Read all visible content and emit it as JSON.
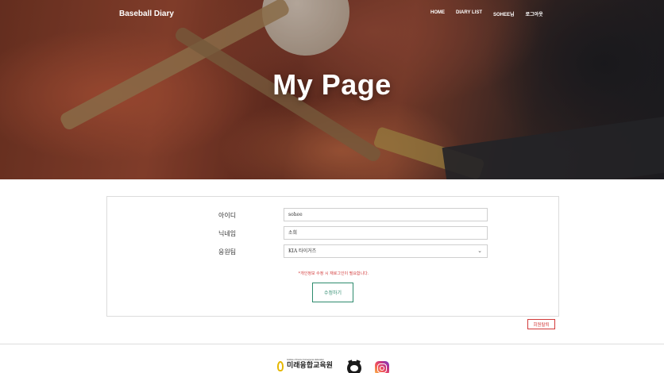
{
  "nav": {
    "brand": "Baseball Diary",
    "links": [
      "HOME",
      "DIARY LIST",
      "SOHEE님",
      "로그아웃"
    ]
  },
  "hero": {
    "title": "My Page"
  },
  "form": {
    "id_label": "아이디",
    "id_value": "sohee",
    "nickname_label": "닉네임",
    "nickname_value": "소희",
    "team_label": "응원팀",
    "team_value": "KIA 타이거즈",
    "notice": "*개인정보 수정 시 재로그인이 필요합니다.",
    "submit_label": "수정하기"
  },
  "withdraw_label": "회원탈퇴",
  "footer": {
    "logo_small": "Institute of Future Convergence Education",
    "logo_big": "미래융합교육원",
    "icons": [
      "github-icon",
      "instagram-icon"
    ]
  },
  "colors": {
    "accent": "#2e8b6e",
    "danger": "#d23a3a"
  }
}
